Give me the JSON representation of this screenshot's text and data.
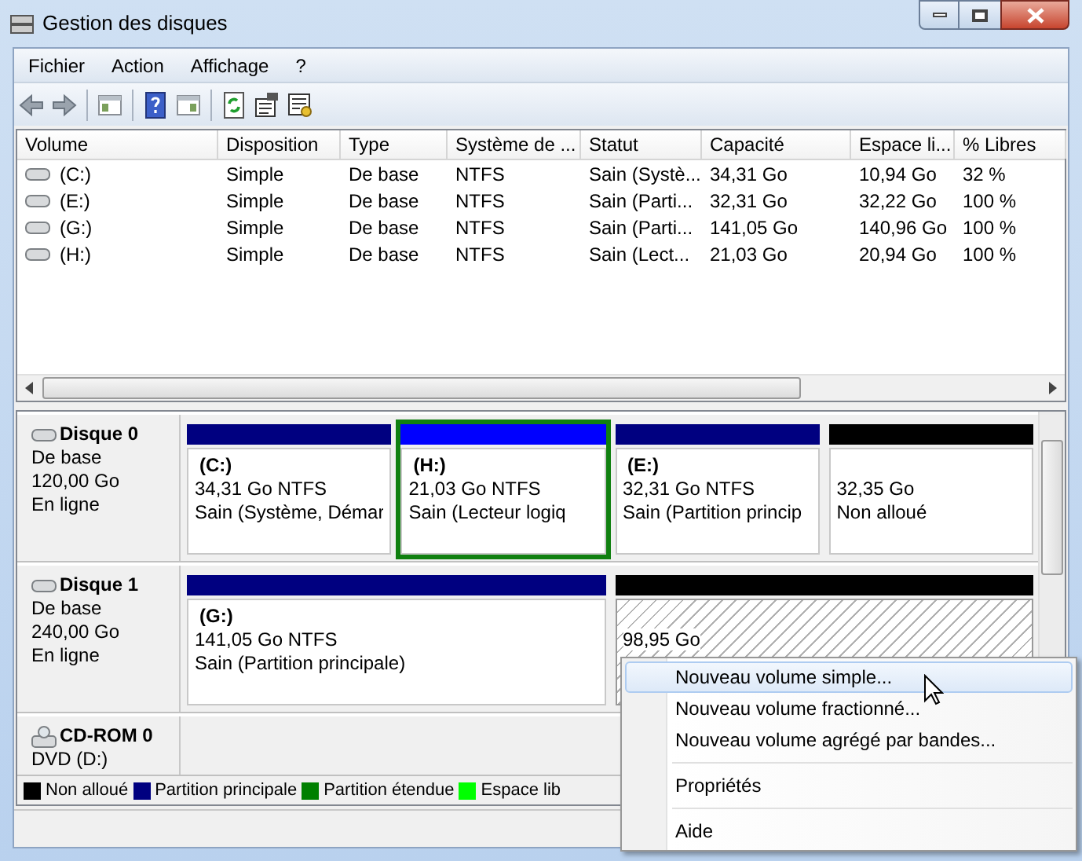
{
  "window": {
    "title": "Gestion des disques"
  },
  "menu": [
    "Fichier",
    "Action",
    "Affichage",
    "?"
  ],
  "toolbar": [
    {
      "kind": "back"
    },
    {
      "kind": "forward"
    },
    {
      "kind": "sep"
    },
    {
      "kind": "panel"
    },
    {
      "kind": "sep"
    },
    {
      "kind": "help"
    },
    {
      "kind": "panel2"
    },
    {
      "kind": "sep"
    },
    {
      "kind": "refresh"
    },
    {
      "kind": "properties"
    },
    {
      "kind": "settings"
    }
  ],
  "table": {
    "columns": [
      "Volume",
      "Disposition",
      "Type",
      "Système de ...",
      "Statut",
      "Capacité",
      "Espace li...",
      "% Libres"
    ],
    "rows": [
      [
        "(C:)",
        "Simple",
        "De base",
        "NTFS",
        "Sain (Systè...",
        "34,31 Go",
        "10,94 Go",
        "32 %"
      ],
      [
        "(E:)",
        "Simple",
        "De base",
        "NTFS",
        "Sain (Parti...",
        "32,31 Go",
        "32,22 Go",
        "100 %"
      ],
      [
        "(G:)",
        "Simple",
        "De base",
        "NTFS",
        "Sain (Parti...",
        "141,05 Go",
        "140,96 Go",
        "100 %"
      ],
      [
        "(H:)",
        "Simple",
        "De base",
        "NTFS",
        "Sain (Lect...",
        "21,03 Go",
        "20,94 Go",
        "100 %"
      ]
    ]
  },
  "disks": [
    {
      "kind": "disk",
      "name": "Disque 0",
      "lines": [
        "De base",
        "120,00 Go",
        "En ligne"
      ],
      "partitions": [
        {
          "kind": "volume",
          "color": "#000080",
          "label": "(C:)",
          "lines": [
            "34,31 Go NTFS",
            "Sain (Système, Démar"
          ],
          "focused": false,
          "selected": false
        },
        {
          "kind": "volume",
          "color": "#0000ff",
          "label": "(H:)",
          "lines": [
            "21,03 Go NTFS",
            "Sain (Lecteur logiq"
          ],
          "focused": true,
          "selected": false
        },
        {
          "kind": "volume",
          "color": "#000080",
          "label": "(E:)",
          "lines": [
            "32,31 Go NTFS",
            "Sain (Partition princip"
          ],
          "focused": false,
          "selected": false
        },
        {
          "kind": "free",
          "color": "#000000",
          "lines": [
            "32,35 Go",
            "Non alloué"
          ],
          "focused": false,
          "selected": false
        }
      ]
    },
    {
      "kind": "disk",
      "name": "Disque 1",
      "lines": [
        "De base",
        "240,00 Go",
        "En ligne"
      ],
      "partitions": [
        {
          "kind": "volume",
          "color": "#000080",
          "label": "(G:)",
          "lines": [
            "141,05 Go NTFS",
            "Sain (Partition principale)"
          ],
          "focused": false,
          "selected": false
        },
        {
          "kind": "free",
          "color": "#000000",
          "lines": [
            "98,95 Go"
          ],
          "focused": false,
          "selected": true
        }
      ]
    },
    {
      "kind": "cdrom",
      "name": "CD-ROM 0",
      "lines": [
        "DVD (D:)"
      ]
    }
  ],
  "legend": [
    {
      "label": "Non alloué",
      "color": "#000000"
    },
    {
      "label": "Partition principale",
      "color": "#000080"
    },
    {
      "label": "Partition étendue",
      "color": "#008000"
    },
    {
      "label": "Espace lib",
      "color": "#00ff00"
    }
  ],
  "context_menu": [
    {
      "kind": "item",
      "label": "Nouveau volume simple...",
      "selected": true
    },
    {
      "kind": "item",
      "label": "Nouveau volume fractionné...",
      "selected": false
    },
    {
      "kind": "item",
      "label": "Nouveau volume agrégé par bandes...",
      "selected": false
    },
    {
      "kind": "sep"
    },
    {
      "kind": "item",
      "label": "Propriétés",
      "selected": false
    },
    {
      "kind": "sep"
    },
    {
      "kind": "item",
      "label": "Aide",
      "selected": false
    }
  ]
}
